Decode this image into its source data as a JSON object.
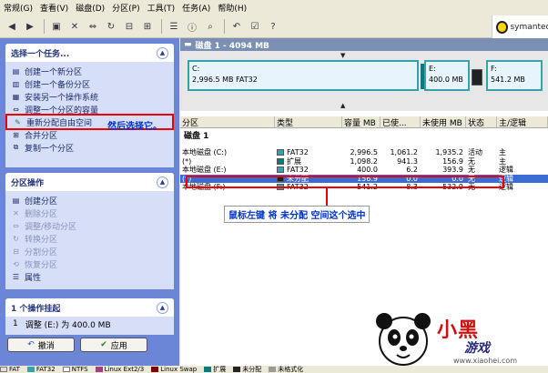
{
  "menu": [
    "常规(G)",
    "查看(V)",
    "磁盘(D)",
    "分区(P)",
    "工具(T)",
    "任务(A)",
    "帮助(H)"
  ],
  "brand": {
    "text": "symantec"
  },
  "left": {
    "tasks": {
      "title": "选择一个任务...",
      "items": [
        "创建一个新分区",
        "创建一个备份分区",
        "安装另一个操作系统",
        "调整一个分区的容量",
        "重新分配自由空间",
        "合并分区",
        "复制一个分区"
      ]
    },
    "annotation1": "然后选择它。",
    "ops": {
      "title": "分区操作",
      "items": [
        "创建分区",
        "删除分区",
        "调整/移动分区",
        "转换分区",
        "分割分区",
        "恢复分区",
        "属性"
      ]
    },
    "pending": {
      "title": "1 个操作挂起",
      "num": "1",
      "text": "调整 (E:) 为 400.0 MB"
    },
    "undo_label": "撤消",
    "apply_label": "应用"
  },
  "disk": {
    "header": "磁盘 1 - 4094 MB",
    "seg_c": {
      "label": "C:",
      "info": "2,996.5 MB   FAT32"
    },
    "seg_e": {
      "label": "E:",
      "info": "400.0 MB"
    },
    "seg_f": {
      "label": "F:",
      "info": "541.2 MB"
    }
  },
  "table": {
    "headers": [
      "分区",
      "类型",
      "容量 MB",
      "已使...",
      "未使用 MB",
      "状态",
      "主/逻辑"
    ],
    "disk_label": "磁盘 1",
    "rows": [
      {
        "name": "本地磁盘 (C:)",
        "type": "FAT32",
        "cap": "2,996.5",
        "used": "1,061.2",
        "free": "1,935.2",
        "status": "活动",
        "kind": "主"
      },
      {
        "name": "(*)",
        "type": "扩展",
        "cap": "1,098.2",
        "used": "941.3",
        "free": "156.9",
        "status": "无",
        "kind": "主"
      },
      {
        "name": "本地磁盘 (E:)",
        "type": "FAT32",
        "cap": "400.0",
        "used": "6.2",
        "free": "393.9",
        "status": "无",
        "kind": "逻辑"
      },
      {
        "name": "(*)",
        "type": "未分配",
        "cap": "156.9",
        "used": "0.0",
        "free": "0.0",
        "status": "无",
        "kind": "逻辑"
      },
      {
        "name": "本地磁盘 (F:)",
        "type": "FAT32",
        "cap": "541.2",
        "used": "8.3",
        "free": "532.9",
        "status": "无",
        "kind": "逻辑"
      }
    ]
  },
  "annotation2": "鼠标左键 将 未分配 空间这个选中",
  "legend": [
    "FAT",
    "FAT32",
    "NTFS",
    "Linux Ext2/3",
    "Linux Swap",
    "扩展",
    "未分配",
    "未格式化"
  ],
  "watermark": {
    "main": "小黑",
    "sub": "游戏",
    "url": "www.xiaohei.com"
  },
  "colors": {
    "fat": "#e0e0e0",
    "fat32": "#3aa0b0",
    "ntfs": "#ffffff",
    "ext": "#0a7a7a",
    "unalloc": "#222222"
  }
}
